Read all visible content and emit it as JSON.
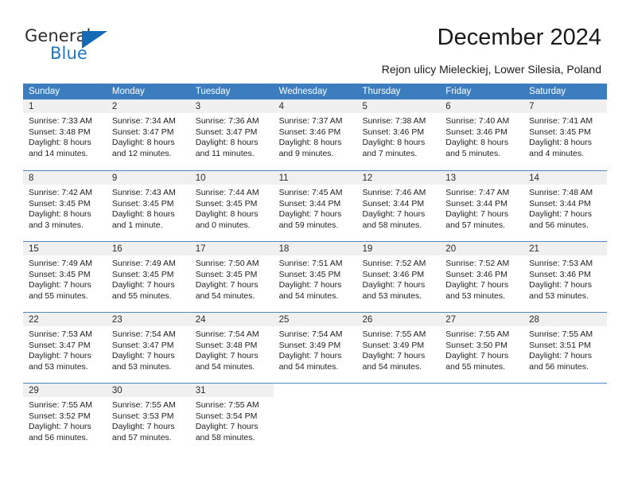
{
  "brand": {
    "name_top": "General",
    "name_bottom": "Blue",
    "accent_color": "#1669b5",
    "logo_icon": "triangle-logo-icon"
  },
  "header": {
    "title": "December 2024",
    "subtitle": "Rejon ulicy Mieleckiej, Lower Silesia, Poland"
  },
  "calendar": {
    "header_bg": "#3c7dc0",
    "day_band_bg": "#f0f0f0",
    "weekdays": [
      "Sunday",
      "Monday",
      "Tuesday",
      "Wednesday",
      "Thursday",
      "Friday",
      "Saturday"
    ],
    "weeks": [
      [
        {
          "day": "1",
          "sunrise": "Sunrise: 7:33 AM",
          "sunset": "Sunset: 3:48 PM",
          "daylight_line1": "Daylight: 8 hours",
          "daylight_line2": "and 14 minutes."
        },
        {
          "day": "2",
          "sunrise": "Sunrise: 7:34 AM",
          "sunset": "Sunset: 3:47 PM",
          "daylight_line1": "Daylight: 8 hours",
          "daylight_line2": "and 12 minutes."
        },
        {
          "day": "3",
          "sunrise": "Sunrise: 7:36 AM",
          "sunset": "Sunset: 3:47 PM",
          "daylight_line1": "Daylight: 8 hours",
          "daylight_line2": "and 11 minutes."
        },
        {
          "day": "4",
          "sunrise": "Sunrise: 7:37 AM",
          "sunset": "Sunset: 3:46 PM",
          "daylight_line1": "Daylight: 8 hours",
          "daylight_line2": "and 9 minutes."
        },
        {
          "day": "5",
          "sunrise": "Sunrise: 7:38 AM",
          "sunset": "Sunset: 3:46 PM",
          "daylight_line1": "Daylight: 8 hours",
          "daylight_line2": "and 7 minutes."
        },
        {
          "day": "6",
          "sunrise": "Sunrise: 7:40 AM",
          "sunset": "Sunset: 3:46 PM",
          "daylight_line1": "Daylight: 8 hours",
          "daylight_line2": "and 5 minutes."
        },
        {
          "day": "7",
          "sunrise": "Sunrise: 7:41 AM",
          "sunset": "Sunset: 3:45 PM",
          "daylight_line1": "Daylight: 8 hours",
          "daylight_line2": "and 4 minutes."
        }
      ],
      [
        {
          "day": "8",
          "sunrise": "Sunrise: 7:42 AM",
          "sunset": "Sunset: 3:45 PM",
          "daylight_line1": "Daylight: 8 hours",
          "daylight_line2": "and 3 minutes."
        },
        {
          "day": "9",
          "sunrise": "Sunrise: 7:43 AM",
          "sunset": "Sunset: 3:45 PM",
          "daylight_line1": "Daylight: 8 hours",
          "daylight_line2": "and 1 minute."
        },
        {
          "day": "10",
          "sunrise": "Sunrise: 7:44 AM",
          "sunset": "Sunset: 3:45 PM",
          "daylight_line1": "Daylight: 8 hours",
          "daylight_line2": "and 0 minutes."
        },
        {
          "day": "11",
          "sunrise": "Sunrise: 7:45 AM",
          "sunset": "Sunset: 3:44 PM",
          "daylight_line1": "Daylight: 7 hours",
          "daylight_line2": "and 59 minutes."
        },
        {
          "day": "12",
          "sunrise": "Sunrise: 7:46 AM",
          "sunset": "Sunset: 3:44 PM",
          "daylight_line1": "Daylight: 7 hours",
          "daylight_line2": "and 58 minutes."
        },
        {
          "day": "13",
          "sunrise": "Sunrise: 7:47 AM",
          "sunset": "Sunset: 3:44 PM",
          "daylight_line1": "Daylight: 7 hours",
          "daylight_line2": "and 57 minutes."
        },
        {
          "day": "14",
          "sunrise": "Sunrise: 7:48 AM",
          "sunset": "Sunset: 3:44 PM",
          "daylight_line1": "Daylight: 7 hours",
          "daylight_line2": "and 56 minutes."
        }
      ],
      [
        {
          "day": "15",
          "sunrise": "Sunrise: 7:49 AM",
          "sunset": "Sunset: 3:45 PM",
          "daylight_line1": "Daylight: 7 hours",
          "daylight_line2": "and 55 minutes."
        },
        {
          "day": "16",
          "sunrise": "Sunrise: 7:49 AM",
          "sunset": "Sunset: 3:45 PM",
          "daylight_line1": "Daylight: 7 hours",
          "daylight_line2": "and 55 minutes."
        },
        {
          "day": "17",
          "sunrise": "Sunrise: 7:50 AM",
          "sunset": "Sunset: 3:45 PM",
          "daylight_line1": "Daylight: 7 hours",
          "daylight_line2": "and 54 minutes."
        },
        {
          "day": "18",
          "sunrise": "Sunrise: 7:51 AM",
          "sunset": "Sunset: 3:45 PM",
          "daylight_line1": "Daylight: 7 hours",
          "daylight_line2": "and 54 minutes."
        },
        {
          "day": "19",
          "sunrise": "Sunrise: 7:52 AM",
          "sunset": "Sunset: 3:46 PM",
          "daylight_line1": "Daylight: 7 hours",
          "daylight_line2": "and 53 minutes."
        },
        {
          "day": "20",
          "sunrise": "Sunrise: 7:52 AM",
          "sunset": "Sunset: 3:46 PM",
          "daylight_line1": "Daylight: 7 hours",
          "daylight_line2": "and 53 minutes."
        },
        {
          "day": "21",
          "sunrise": "Sunrise: 7:53 AM",
          "sunset": "Sunset: 3:46 PM",
          "daylight_line1": "Daylight: 7 hours",
          "daylight_line2": "and 53 minutes."
        }
      ],
      [
        {
          "day": "22",
          "sunrise": "Sunrise: 7:53 AM",
          "sunset": "Sunset: 3:47 PM",
          "daylight_line1": "Daylight: 7 hours",
          "daylight_line2": "and 53 minutes."
        },
        {
          "day": "23",
          "sunrise": "Sunrise: 7:54 AM",
          "sunset": "Sunset: 3:47 PM",
          "daylight_line1": "Daylight: 7 hours",
          "daylight_line2": "and 53 minutes."
        },
        {
          "day": "24",
          "sunrise": "Sunrise: 7:54 AM",
          "sunset": "Sunset: 3:48 PM",
          "daylight_line1": "Daylight: 7 hours",
          "daylight_line2": "and 54 minutes."
        },
        {
          "day": "25",
          "sunrise": "Sunrise: 7:54 AM",
          "sunset": "Sunset: 3:49 PM",
          "daylight_line1": "Daylight: 7 hours",
          "daylight_line2": "and 54 minutes."
        },
        {
          "day": "26",
          "sunrise": "Sunrise: 7:55 AM",
          "sunset": "Sunset: 3:49 PM",
          "daylight_line1": "Daylight: 7 hours",
          "daylight_line2": "and 54 minutes."
        },
        {
          "day": "27",
          "sunrise": "Sunrise: 7:55 AM",
          "sunset": "Sunset: 3:50 PM",
          "daylight_line1": "Daylight: 7 hours",
          "daylight_line2": "and 55 minutes."
        },
        {
          "day": "28",
          "sunrise": "Sunrise: 7:55 AM",
          "sunset": "Sunset: 3:51 PM",
          "daylight_line1": "Daylight: 7 hours",
          "daylight_line2": "and 56 minutes."
        }
      ],
      [
        {
          "day": "29",
          "sunrise": "Sunrise: 7:55 AM",
          "sunset": "Sunset: 3:52 PM",
          "daylight_line1": "Daylight: 7 hours",
          "daylight_line2": "and 56 minutes."
        },
        {
          "day": "30",
          "sunrise": "Sunrise: 7:55 AM",
          "sunset": "Sunset: 3:53 PM",
          "daylight_line1": "Daylight: 7 hours",
          "daylight_line2": "and 57 minutes."
        },
        {
          "day": "31",
          "sunrise": "Sunrise: 7:55 AM",
          "sunset": "Sunset: 3:54 PM",
          "daylight_line1": "Daylight: 7 hours",
          "daylight_line2": "and 58 minutes."
        },
        {
          "day": "",
          "sunrise": "",
          "sunset": "",
          "daylight_line1": "",
          "daylight_line2": ""
        },
        {
          "day": "",
          "sunrise": "",
          "sunset": "",
          "daylight_line1": "",
          "daylight_line2": ""
        },
        {
          "day": "",
          "sunrise": "",
          "sunset": "",
          "daylight_line1": "",
          "daylight_line2": ""
        },
        {
          "day": "",
          "sunrise": "",
          "sunset": "",
          "daylight_line1": "",
          "daylight_line2": ""
        }
      ]
    ]
  }
}
